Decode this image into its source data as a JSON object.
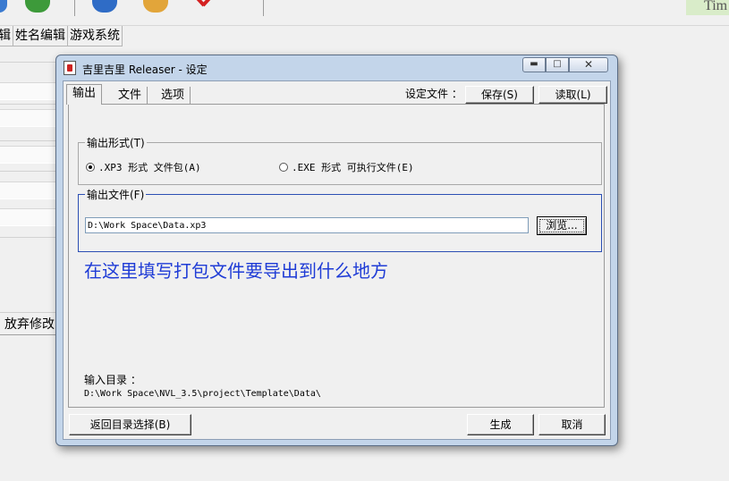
{
  "background_app": {
    "menu_items": [
      "辑",
      "姓名编辑",
      "游戏系统"
    ],
    "corner_text": "Tim",
    "discard_button": "放弃修改"
  },
  "dialog": {
    "title": "吉里吉里 Releaser - 设定",
    "tabs": [
      "输出",
      "文件",
      "选项"
    ],
    "settings_file_label": "设定文件 ：",
    "save_button": "保存(S)",
    "load_button": "读取(L)",
    "output_format": {
      "title": "输出形式(T)",
      "options": [
        {
          "label": ".XP3 形式 文件包(A)",
          "selected": true
        },
        {
          "label": ".EXE 形式 可执行文件(E)",
          "selected": false
        }
      ]
    },
    "output_file": {
      "title": "输出文件(F)",
      "path": "D:\\Work Space\\Data.xp3",
      "browse_button": "浏览..."
    },
    "annotation": "在这里填写打包文件要导出到什么地方",
    "input_dir": {
      "label": "输入目录 ：",
      "path": "D:\\Work Space\\NVL_3.5\\project\\Template\\Data\\"
    },
    "back_button": "返回目录选择(B)",
    "generate_button": "生成",
    "cancel_button": "取消"
  },
  "colors": {
    "annotation": "#1f3cd6",
    "frame": "#c3d5ea",
    "group_highlight": "#2c4fb4"
  }
}
